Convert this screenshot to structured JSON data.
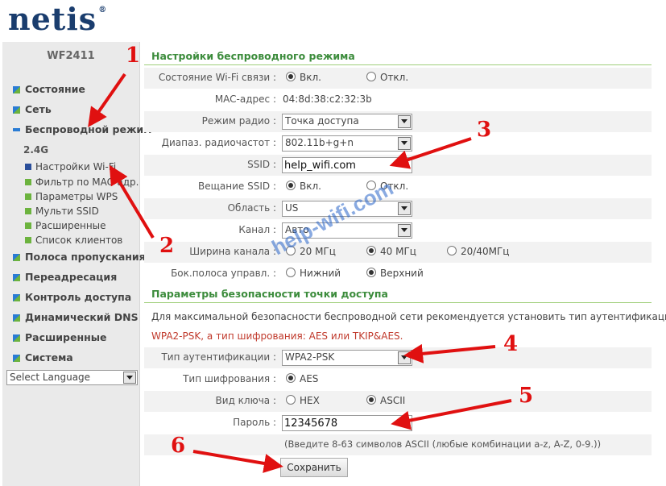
{
  "logo": {
    "text": "netis",
    "mark": "®"
  },
  "sidebar": {
    "model": "WF2411",
    "items": [
      {
        "label": "Состояние"
      },
      {
        "label": "Сеть"
      },
      {
        "label": "Беспроводной режим"
      },
      {
        "label": "Полоса пропускания"
      },
      {
        "label": "Переадресация"
      },
      {
        "label": "Контроль доступа"
      },
      {
        "label": "Динамический DNS"
      },
      {
        "label": "Расширенные"
      },
      {
        "label": "Система"
      }
    ],
    "band": "2.4G",
    "subitems": [
      {
        "label": "Настройки Wi-Fi"
      },
      {
        "label": "Фильтр по MAC-адр."
      },
      {
        "label": "Параметры WPS"
      },
      {
        "label": "Мульти SSID"
      },
      {
        "label": "Расширенные"
      },
      {
        "label": "Список клиентов"
      }
    ],
    "language": "Select Language"
  },
  "wireless": {
    "title": "Настройки беспроводного режима",
    "wifi_status_label": "Состояние Wi-Fi связи :",
    "on": "Вкл.",
    "off": "Откл.",
    "mac_label": "MAC-адрес :",
    "mac_value": "04:8d:38:c2:32:3b",
    "radio_mode_label": "Режим радио :",
    "radio_mode_value": "Точка доступа",
    "band_label": "Диапаз. радиочастот :",
    "band_value": "802.11b+g+n",
    "ssid_label": "SSID :",
    "ssid_value": "help_wifi.com",
    "broadcast_label": "Вещание SSID :",
    "region_label": "Область :",
    "region_value": "US",
    "channel_label": "Канал :",
    "channel_value": "Авто",
    "width_label": "Ширина канала :",
    "width_20": "20 МГц",
    "width_40": "40 МГц",
    "width_2040": "20/40МГц",
    "sideband_label": "Бок.полоса управл. :",
    "sideband_low": "Нижний",
    "sideband_high": "Верхний"
  },
  "security": {
    "title": "Параметры безопасности точки доступа",
    "note1": "Для максимальной безопасности беспроводной сети рекомендуется установить тип аутентификации:",
    "note2": "WPA2-PSK, а тип шифрования: AES или TKIP&AES.",
    "auth_label": "Тип аутентификации :",
    "auth_value": "WPA2-PSK",
    "cipher_label": "Тип шифрования :",
    "cipher_value": "AES",
    "keytype_label": "Вид ключа :",
    "key_hex": "HEX",
    "key_ascii": "ASCII",
    "password_label": "Пароль :",
    "password_value": "12345678",
    "password_hint": "(Введите 8-63 символов ASCII (любые комбинации a-z, A-Z, 0-9.))",
    "save_label": "Сохранить"
  },
  "annotations": {
    "n1": "1",
    "n2": "2",
    "n3": "3",
    "n4": "4",
    "n5": "5",
    "n6": "6",
    "watermark": "help-wifi.com",
    "arrow_color": "#e01010"
  }
}
